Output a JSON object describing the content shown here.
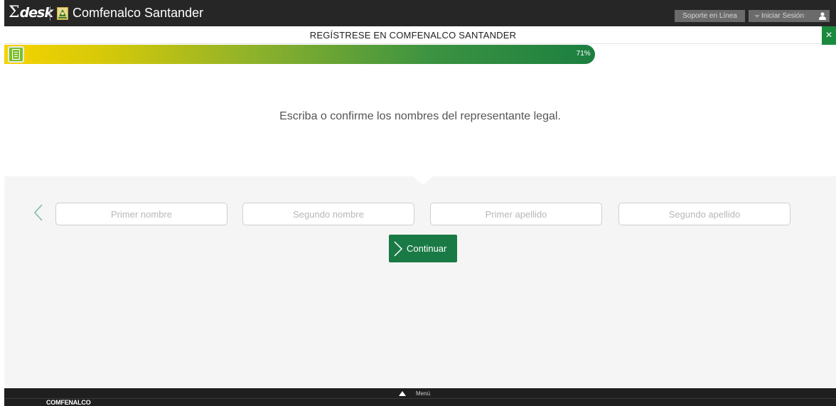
{
  "header": {
    "logo_sigma": "Σ",
    "logo_text": "desk",
    "brand_name": "Comfenalco Santander",
    "support_label": "Soporte en Línea",
    "login_label": "Iniciar Sesión",
    "brand_icon": "comfenalco-emblem-icon",
    "user_icon": "user-icon"
  },
  "registration": {
    "title": "REGÍSTRESE EN COMFENALCO SANTANDER",
    "close_label": "×",
    "progress_percent": 71,
    "progress_label": "71%",
    "progress_icon": "document-icon"
  },
  "question": {
    "prompt": "Escriba o confirme los nombres del representante legal."
  },
  "form": {
    "first_name_placeholder": "Primer nombre",
    "second_name_placeholder": "Segundo nombre",
    "first_surname_placeholder": "Primer apellido",
    "second_surname_placeholder": "Segundo apellido",
    "continue_label": "Continuar"
  },
  "footer": {
    "menu_label": "Menú",
    "brand_label": "COMFENALCO"
  },
  "colors": {
    "primary_green": "#1a7a45",
    "progress_start": "#f7d300",
    "progress_end": "#1b7f40",
    "topbar": "#262626"
  }
}
